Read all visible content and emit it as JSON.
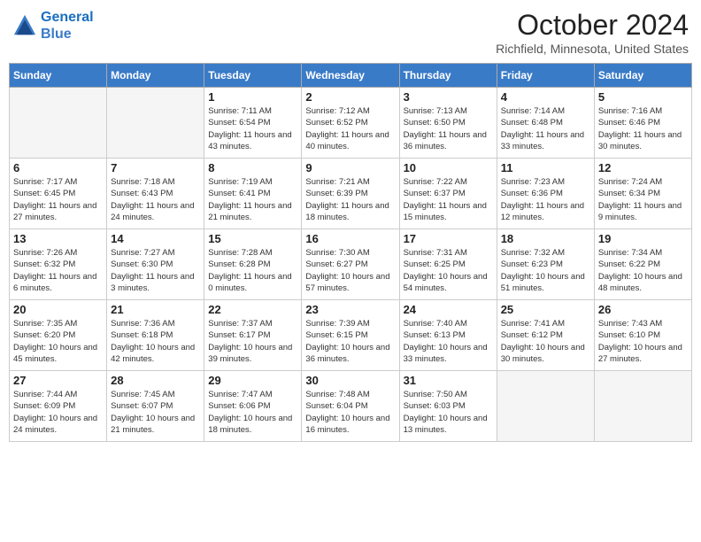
{
  "header": {
    "logo_line1": "General",
    "logo_line2": "Blue",
    "month_title": "October 2024",
    "location": "Richfield, Minnesota, United States"
  },
  "days_of_week": [
    "Sunday",
    "Monday",
    "Tuesday",
    "Wednesday",
    "Thursday",
    "Friday",
    "Saturday"
  ],
  "weeks": [
    [
      {
        "num": "",
        "empty": true
      },
      {
        "num": "",
        "empty": true
      },
      {
        "num": "1",
        "sunrise": "7:11 AM",
        "sunset": "6:54 PM",
        "daylight": "11 hours and 43 minutes."
      },
      {
        "num": "2",
        "sunrise": "7:12 AM",
        "sunset": "6:52 PM",
        "daylight": "11 hours and 40 minutes."
      },
      {
        "num": "3",
        "sunrise": "7:13 AM",
        "sunset": "6:50 PM",
        "daylight": "11 hours and 36 minutes."
      },
      {
        "num": "4",
        "sunrise": "7:14 AM",
        "sunset": "6:48 PM",
        "daylight": "11 hours and 33 minutes."
      },
      {
        "num": "5",
        "sunrise": "7:16 AM",
        "sunset": "6:46 PM",
        "daylight": "11 hours and 30 minutes."
      }
    ],
    [
      {
        "num": "6",
        "sunrise": "7:17 AM",
        "sunset": "6:45 PM",
        "daylight": "11 hours and 27 minutes."
      },
      {
        "num": "7",
        "sunrise": "7:18 AM",
        "sunset": "6:43 PM",
        "daylight": "11 hours and 24 minutes."
      },
      {
        "num": "8",
        "sunrise": "7:19 AM",
        "sunset": "6:41 PM",
        "daylight": "11 hours and 21 minutes."
      },
      {
        "num": "9",
        "sunrise": "7:21 AM",
        "sunset": "6:39 PM",
        "daylight": "11 hours and 18 minutes."
      },
      {
        "num": "10",
        "sunrise": "7:22 AM",
        "sunset": "6:37 PM",
        "daylight": "11 hours and 15 minutes."
      },
      {
        "num": "11",
        "sunrise": "7:23 AM",
        "sunset": "6:36 PM",
        "daylight": "11 hours and 12 minutes."
      },
      {
        "num": "12",
        "sunrise": "7:24 AM",
        "sunset": "6:34 PM",
        "daylight": "11 hours and 9 minutes."
      }
    ],
    [
      {
        "num": "13",
        "sunrise": "7:26 AM",
        "sunset": "6:32 PM",
        "daylight": "11 hours and 6 minutes."
      },
      {
        "num": "14",
        "sunrise": "7:27 AM",
        "sunset": "6:30 PM",
        "daylight": "11 hours and 3 minutes."
      },
      {
        "num": "15",
        "sunrise": "7:28 AM",
        "sunset": "6:28 PM",
        "daylight": "11 hours and 0 minutes."
      },
      {
        "num": "16",
        "sunrise": "7:30 AM",
        "sunset": "6:27 PM",
        "daylight": "10 hours and 57 minutes."
      },
      {
        "num": "17",
        "sunrise": "7:31 AM",
        "sunset": "6:25 PM",
        "daylight": "10 hours and 54 minutes."
      },
      {
        "num": "18",
        "sunrise": "7:32 AM",
        "sunset": "6:23 PM",
        "daylight": "10 hours and 51 minutes."
      },
      {
        "num": "19",
        "sunrise": "7:34 AM",
        "sunset": "6:22 PM",
        "daylight": "10 hours and 48 minutes."
      }
    ],
    [
      {
        "num": "20",
        "sunrise": "7:35 AM",
        "sunset": "6:20 PM",
        "daylight": "10 hours and 45 minutes."
      },
      {
        "num": "21",
        "sunrise": "7:36 AM",
        "sunset": "6:18 PM",
        "daylight": "10 hours and 42 minutes."
      },
      {
        "num": "22",
        "sunrise": "7:37 AM",
        "sunset": "6:17 PM",
        "daylight": "10 hours and 39 minutes."
      },
      {
        "num": "23",
        "sunrise": "7:39 AM",
        "sunset": "6:15 PM",
        "daylight": "10 hours and 36 minutes."
      },
      {
        "num": "24",
        "sunrise": "7:40 AM",
        "sunset": "6:13 PM",
        "daylight": "10 hours and 33 minutes."
      },
      {
        "num": "25",
        "sunrise": "7:41 AM",
        "sunset": "6:12 PM",
        "daylight": "10 hours and 30 minutes."
      },
      {
        "num": "26",
        "sunrise": "7:43 AM",
        "sunset": "6:10 PM",
        "daylight": "10 hours and 27 minutes."
      }
    ],
    [
      {
        "num": "27",
        "sunrise": "7:44 AM",
        "sunset": "6:09 PM",
        "daylight": "10 hours and 24 minutes."
      },
      {
        "num": "28",
        "sunrise": "7:45 AM",
        "sunset": "6:07 PM",
        "daylight": "10 hours and 21 minutes."
      },
      {
        "num": "29",
        "sunrise": "7:47 AM",
        "sunset": "6:06 PM",
        "daylight": "10 hours and 18 minutes."
      },
      {
        "num": "30",
        "sunrise": "7:48 AM",
        "sunset": "6:04 PM",
        "daylight": "10 hours and 16 minutes."
      },
      {
        "num": "31",
        "sunrise": "7:50 AM",
        "sunset": "6:03 PM",
        "daylight": "10 hours and 13 minutes."
      },
      {
        "num": "",
        "empty": true
      },
      {
        "num": "",
        "empty": true
      }
    ]
  ],
  "labels": {
    "sunrise": "Sunrise:",
    "sunset": "Sunset:",
    "daylight": "Daylight:"
  }
}
